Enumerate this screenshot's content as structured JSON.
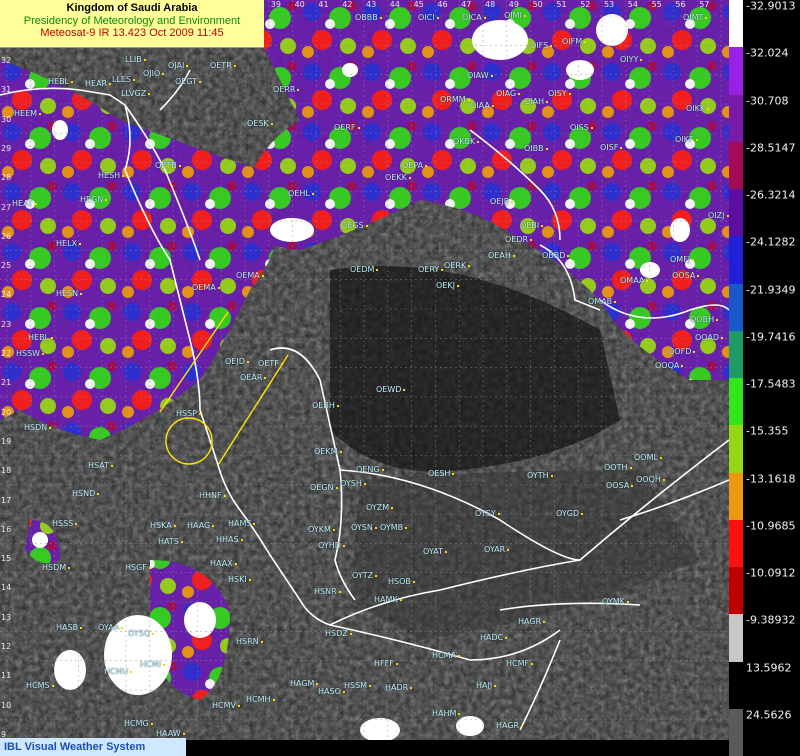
{
  "header": {
    "line1": "Kingdom of Saudi Arabia",
    "line2": "Presidency of Meteorology and Environment",
    "line3": "Meteosat-9 IR 13.423 Oct 2009 11:45"
  },
  "footer": {
    "label": "IBL Visual Weather System"
  },
  "colors": {
    "header_bg": "#ffff99",
    "footer_bg": "#cfe7ff",
    "station_label": "#bff3ff",
    "coastline": "#ffffff",
    "annotation": "#ffe400"
  },
  "latitudes": [
    "32",
    "31",
    "30",
    "29",
    "28",
    "27",
    "26",
    "25",
    "24",
    "23",
    "22",
    "21",
    "20",
    "19",
    "18",
    "17",
    "16",
    "15",
    "14",
    "13",
    "12",
    "11",
    "10",
    "9"
  ],
  "longitudes": [
    "33",
    "34",
    "35",
    "36",
    "37",
    "38",
    "39",
    "40",
    "41",
    "42",
    "43",
    "44",
    "45",
    "46",
    "47",
    "48",
    "49",
    "50",
    "51",
    "52",
    "53",
    "54",
    "55",
    "56",
    "57"
  ],
  "longitudes_bottom": [
    "34",
    "35",
    "36",
    "37",
    "38",
    "39",
    "40",
    "41",
    "42",
    "43",
    "44",
    "45",
    "46",
    "47",
    "48",
    "49",
    "50",
    "51",
    "52",
    "53",
    "54",
    "55",
    "56",
    "57"
  ],
  "stations": [
    {
      "id": "OBBB"
    },
    {
      "id": "OICI"
    },
    {
      "id": "OICA"
    },
    {
      "id": "OIMI"
    },
    {
      "id": "OJAI"
    },
    {
      "id": "OETR"
    },
    {
      "id": "LLIB"
    },
    {
      "id": "OJIO"
    },
    {
      "id": "OEGT"
    },
    {
      "id": "HEAR"
    },
    {
      "id": "LLES"
    },
    {
      "id": "LLVGZ"
    },
    {
      "id": "OERR"
    },
    {
      "id": "OIAW"
    },
    {
      "id": "OIFS"
    },
    {
      "id": "OIFM"
    },
    {
      "id": "OIYY"
    },
    {
      "id": "OIMT"
    },
    {
      "id": "OIAG"
    },
    {
      "id": "OIAH"
    },
    {
      "id": "OISY"
    },
    {
      "id": "OIKK"
    },
    {
      "id": "HEBL"
    },
    {
      "id": "HEEM"
    },
    {
      "id": "OESK"
    },
    {
      "id": "OERF"
    },
    {
      "id": "ORMM"
    },
    {
      "id": "OIAA"
    },
    {
      "id": "OKBK"
    },
    {
      "id": "OIBB"
    },
    {
      "id": "OISS"
    },
    {
      "id": "OISF"
    },
    {
      "id": "OIKF"
    },
    {
      "id": "OEPA"
    },
    {
      "id": "OEKK"
    },
    {
      "id": "OETB"
    },
    {
      "id": "HESH"
    },
    {
      "id": "OEHL"
    },
    {
      "id": "HEAT"
    },
    {
      "id": "HEGN"
    },
    {
      "id": "OEJB"
    },
    {
      "id": "OIZJ"
    },
    {
      "id": "OEGS"
    },
    {
      "id": "OEBI"
    },
    {
      "id": "OEDR"
    },
    {
      "id": "OEDM"
    },
    {
      "id": "HELX"
    },
    {
      "id": "OEAH"
    },
    {
      "id": "OBBD"
    },
    {
      "id": "OMFJ"
    },
    {
      "id": "OERY"
    },
    {
      "id": "OERK"
    },
    {
      "id": "OEKJ"
    },
    {
      "id": "OEMA"
    },
    {
      "id": "OMAA"
    },
    {
      "id": "OOSA"
    },
    {
      "id": "HESN"
    },
    {
      "id": "OEMA"
    },
    {
      "id": "OMAB"
    },
    {
      "id": "OOBH"
    },
    {
      "id": "HEBL"
    },
    {
      "id": "HSSW"
    },
    {
      "id": "OEJD"
    },
    {
      "id": "OETF"
    },
    {
      "id": "OEAR"
    },
    {
      "id": "OOAD"
    },
    {
      "id": "OOFD"
    },
    {
      "id": "OOQA"
    },
    {
      "id": "OEWD"
    },
    {
      "id": "OEBH"
    },
    {
      "id": "HSDN"
    },
    {
      "id": "HSSP"
    },
    {
      "id": "OEKM"
    },
    {
      "id": "OENG"
    },
    {
      "id": "OESH"
    },
    {
      "id": "OYTH"
    },
    {
      "id": "OOTH"
    },
    {
      "id": "OOML"
    },
    {
      "id": "OOSA"
    },
    {
      "id": "OOQH"
    },
    {
      "id": "HSAT"
    },
    {
      "id": "HSND"
    },
    {
      "id": "HHNF"
    },
    {
      "id": "OEGN"
    },
    {
      "id": "OYSH"
    },
    {
      "id": "OYZM"
    },
    {
      "id": "OYMB"
    },
    {
      "id": "OYSY"
    },
    {
      "id": "OYGD"
    },
    {
      "id": "HSSS"
    },
    {
      "id": "HSKA"
    },
    {
      "id": "HAAG"
    },
    {
      "id": "HAMS"
    },
    {
      "id": "OYKM"
    },
    {
      "id": "OYSN"
    },
    {
      "id": "OYHD"
    },
    {
      "id": "HATS"
    },
    {
      "id": "HHAS"
    },
    {
      "id": "OYAT"
    },
    {
      "id": "OYAR"
    },
    {
      "id": "HSDM"
    },
    {
      "id": "HSGF"
    },
    {
      "id": "HAAX"
    },
    {
      "id": "OYTZ"
    },
    {
      "id": "HSOB"
    },
    {
      "id": "HSKI"
    },
    {
      "id": "HSNR"
    },
    {
      "id": "HAMK"
    },
    {
      "id": "OYMK"
    },
    {
      "id": "HASB"
    },
    {
      "id": "OYAA"
    },
    {
      "id": "OYSQ"
    },
    {
      "id": "HSRN"
    },
    {
      "id": "HSDZ"
    },
    {
      "id": "HAGR"
    },
    {
      "id": "HADC"
    },
    {
      "id": "HFFF"
    },
    {
      "id": "HCMA"
    },
    {
      "id": "HCMF"
    },
    {
      "id": "HCMI"
    },
    {
      "id": "HCMU"
    },
    {
      "id": "HCMS"
    },
    {
      "id": "HAGM"
    },
    {
      "id": "HASO"
    },
    {
      "id": "HSSM"
    },
    {
      "id": "HADR"
    },
    {
      "id": "HAJJ"
    },
    {
      "id": "HCMH"
    },
    {
      "id": "HCMV"
    },
    {
      "id": "HCMG"
    },
    {
      "id": "HAAW"
    },
    {
      "id": "HAHM"
    },
    {
      "id": "HAGR"
    },
    {
      "id": "HAIM"
    },
    {
      "id": "HCMP"
    },
    {
      "id": "HCME"
    }
  ],
  "scale": [
    {
      "label": "-32.9013",
      "color": "#ffffff"
    },
    {
      "label": "-32.024",
      "color": "#9a20e6"
    },
    {
      "label": "-30.708",
      "color": "#7a1aa8"
    },
    {
      "label": "-28.5147",
      "color": "#a30a58"
    },
    {
      "label": "-26.3214",
      "color": "#5a0fa0"
    },
    {
      "label": "-24.1282",
      "color": "#2020d8"
    },
    {
      "label": "-21.9349",
      "color": "#1a58c8"
    },
    {
      "label": "-19.7416",
      "color": "#1e9a66"
    },
    {
      "label": "-17.5483",
      "color": "#32e61e"
    },
    {
      "label": "-15.355",
      "color": "#96d614"
    },
    {
      "label": "-13.1618",
      "color": "#ee9812"
    },
    {
      "label": "-10.9685",
      "color": "#ff1010"
    },
    {
      "label": "-10.0912",
      "color": "#c00000"
    },
    {
      "label": "-9.38932",
      "color": "#c8c8c8"
    },
    {
      "label": "13.5962",
      "color": "#000000"
    },
    {
      "label": "24.5626",
      "color": "#5a5a5a"
    }
  ]
}
